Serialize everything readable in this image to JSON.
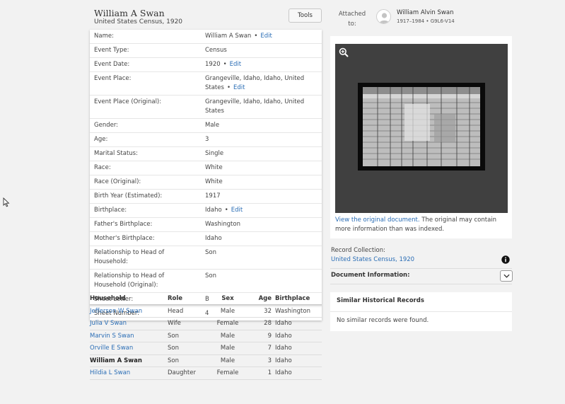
{
  "header": {
    "name": "William A Swan",
    "subtitle": "United States Census, 1920",
    "tools_label": "Tools"
  },
  "attached": {
    "label_line1": "Attached",
    "label_line2": "to:",
    "person_name": "William Alvin Swan",
    "person_details": "1917–1984 • G9L6-V14"
  },
  "details": {
    "edit_label": "Edit",
    "rows": [
      {
        "label": "Name:",
        "value": "William A Swan",
        "edit": true
      },
      {
        "label": "Event Type:",
        "value": "Census",
        "edit": false
      },
      {
        "label": "Event Date:",
        "value": "1920",
        "edit": true
      },
      {
        "label": "Event Place:",
        "value": "Grangeville, Idaho, Idaho, United States",
        "edit": true
      },
      {
        "label": "Event Place (Original):",
        "value": "Grangeville, Idaho, Idaho, United States",
        "edit": false
      },
      {
        "label": "Gender:",
        "value": "Male",
        "edit": false
      },
      {
        "label": "Age:",
        "value": "3",
        "edit": false
      },
      {
        "label": "Marital Status:",
        "value": "Single",
        "edit": false
      },
      {
        "label": "Race:",
        "value": "White",
        "edit": false
      },
      {
        "label": "Race (Original):",
        "value": "White",
        "edit": false
      },
      {
        "label": "Birth Year (Estimated):",
        "value": "1917",
        "edit": false
      },
      {
        "label": "Birthplace:",
        "value": "Idaho",
        "edit": true
      },
      {
        "label": "Father's Birthplace:",
        "value": "Washington",
        "edit": false
      },
      {
        "label": "Mother's Birthplace:",
        "value": "Idaho",
        "edit": false
      },
      {
        "label": "Relationship to Head of Household:",
        "value": "Son",
        "edit": false
      },
      {
        "label": "Relationship to Head of Household (Original):",
        "value": "Son",
        "edit": false
      },
      {
        "label": "Sheet Letter:",
        "value": "B",
        "edit": false
      },
      {
        "label": "Sheet Number:",
        "value": "4",
        "edit": false
      }
    ]
  },
  "household": {
    "headers": [
      "Household",
      "Role",
      "Sex",
      "Age",
      "Birthplace"
    ],
    "rows": [
      {
        "name": "Jefferson W Swan",
        "role": "Head",
        "sex": "Male",
        "age": "32",
        "birthplace": "Washington",
        "link": true
      },
      {
        "name": "Julia V Swan",
        "role": "Wife",
        "sex": "Female",
        "age": "28",
        "birthplace": "Idaho",
        "link": true
      },
      {
        "name": "Marvin S Swan",
        "role": "Son",
        "sex": "Male",
        "age": "9",
        "birthplace": "Idaho",
        "link": true
      },
      {
        "name": "Orville E Swan",
        "role": "Son",
        "sex": "Male",
        "age": "7",
        "birthplace": "Idaho",
        "link": true
      },
      {
        "name": "William A Swan",
        "role": "Son",
        "sex": "Male",
        "age": "3",
        "birthplace": "Idaho",
        "link": false
      },
      {
        "name": "Hildia L Swan",
        "role": "Daughter",
        "sex": "Female",
        "age": "1",
        "birthplace": "Idaho",
        "link": true
      }
    ]
  },
  "image_panel": {
    "view_link": "View the original document.",
    "note": " The original may contain more information than was indexed."
  },
  "record_collection": {
    "label": "Record Collection:",
    "value": "United States Census, 1920"
  },
  "document_information": {
    "label": "Document Information:"
  },
  "similar_records": {
    "title": "Similar Historical Records",
    "empty_message": "No similar records were found."
  },
  "colors": {
    "link": "#2a6db5",
    "background": "#f2f2f2",
    "viewer_bg": "#404040"
  }
}
